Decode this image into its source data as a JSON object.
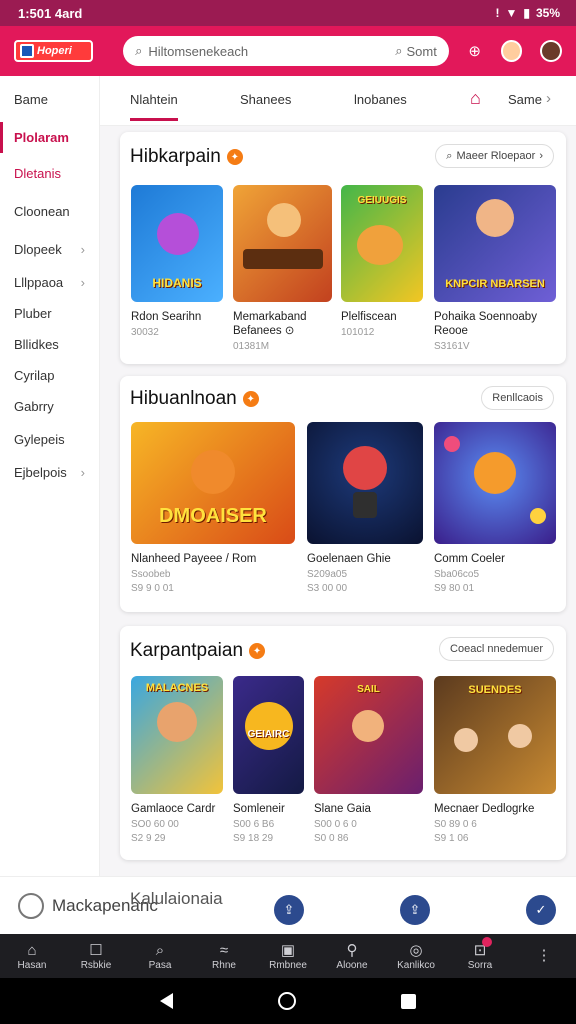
{
  "status": {
    "time": "1:501 4ard",
    "battery": "35%"
  },
  "header": {
    "logo_text": "Hoperi",
    "search_placeholder": "Hiltomsenekeach",
    "search_button": "Somt"
  },
  "sidebar": {
    "items": [
      {
        "label": "Bame"
      },
      {
        "label": "Plolaram"
      },
      {
        "label": "Dletanis"
      },
      {
        "label": "Cloonean"
      },
      {
        "label": "Dlopeek"
      },
      {
        "label": "Lllppaoa"
      },
      {
        "label": "Pluber"
      },
      {
        "label": "Bllidkes"
      },
      {
        "label": "Cyrilap"
      },
      {
        "label": "Gabrry"
      },
      {
        "label": "Gylepeis"
      },
      {
        "label": "Ejbelpois"
      }
    ]
  },
  "tabs": [
    {
      "label": "Nlahtein"
    },
    {
      "label": "Shanees"
    },
    {
      "label": "lnobanes"
    },
    {
      "label": "Same"
    }
  ],
  "sections": [
    {
      "title": "Hibkarpain",
      "action": "Maeer Rloepaor",
      "cards": [
        {
          "title": "Rdon Searihn",
          "meta": "30032",
          "art": "HIDANIS"
        },
        {
          "title": "Memarkaband Befanees ⊙",
          "meta": "01381M",
          "art": ""
        },
        {
          "title": "Plelfiscean",
          "meta": "101012",
          "art": "GEIUUGIS"
        },
        {
          "title": "Pohaika Soennoaby Reooe",
          "meta": "S3161V",
          "art": "KNPCIR NBARSEN"
        }
      ]
    },
    {
      "title": "Hibuanlnoan",
      "action": "Renllcaois",
      "cards": [
        {
          "title": "Nlanheed Payeee / Rom",
          "meta": "Ssoobeb",
          "meta2": "S9 9 0 01",
          "art": "DMOAISER"
        },
        {
          "title": "Goelenaen Ghie",
          "meta": "S209a05",
          "meta2": "S3 00 00",
          "art": ""
        },
        {
          "title": "Comm Coeler",
          "meta": "Sba06co5",
          "meta2": "S9 80 01",
          "art": ""
        }
      ]
    },
    {
      "title": "Karpantpaian",
      "action": "Coeacl nnedemuer",
      "cards": [
        {
          "title": "Gamlaoce Cardr",
          "meta": "SO0 60 00",
          "meta2": "S2 9 29",
          "art": "MALACNES"
        },
        {
          "title": "Somleneir",
          "meta": "S00 6 B6",
          "meta2": "S9 18 29",
          "art": "GEIAIRC"
        },
        {
          "title": "Slane Gaia",
          "meta": "S00 0 6 0",
          "meta2": "S0 0 86",
          "art": "SAIL"
        },
        {
          "title": "Mecnaer Dedlogrke",
          "meta": "S0 89 0 6",
          "meta2": "S9 1 06",
          "art": "SUENDES"
        }
      ]
    }
  ],
  "float_bar": {
    "left_label": "Mackapenanc",
    "title": "Kalulaionaia"
  },
  "bottom_nav": [
    {
      "label": "Hasan",
      "icon": "⌂"
    },
    {
      "label": "Rsbkie",
      "icon": "☐"
    },
    {
      "label": "Pasa",
      "icon": "⌕"
    },
    {
      "label": "Rhne",
      "icon": "≈"
    },
    {
      "label": "Rmbnee",
      "icon": "▣"
    },
    {
      "label": "Aloone",
      "icon": "⚲"
    },
    {
      "label": "Kanlikco",
      "icon": "◎"
    },
    {
      "label": "Sorra",
      "icon": "⊡"
    },
    {
      "label": "",
      "icon": "⋮"
    }
  ],
  "colors": {
    "accent": "#c8104d",
    "header": "#e2185a",
    "status": "#9b1b52",
    "nav": "#1e1e22"
  }
}
